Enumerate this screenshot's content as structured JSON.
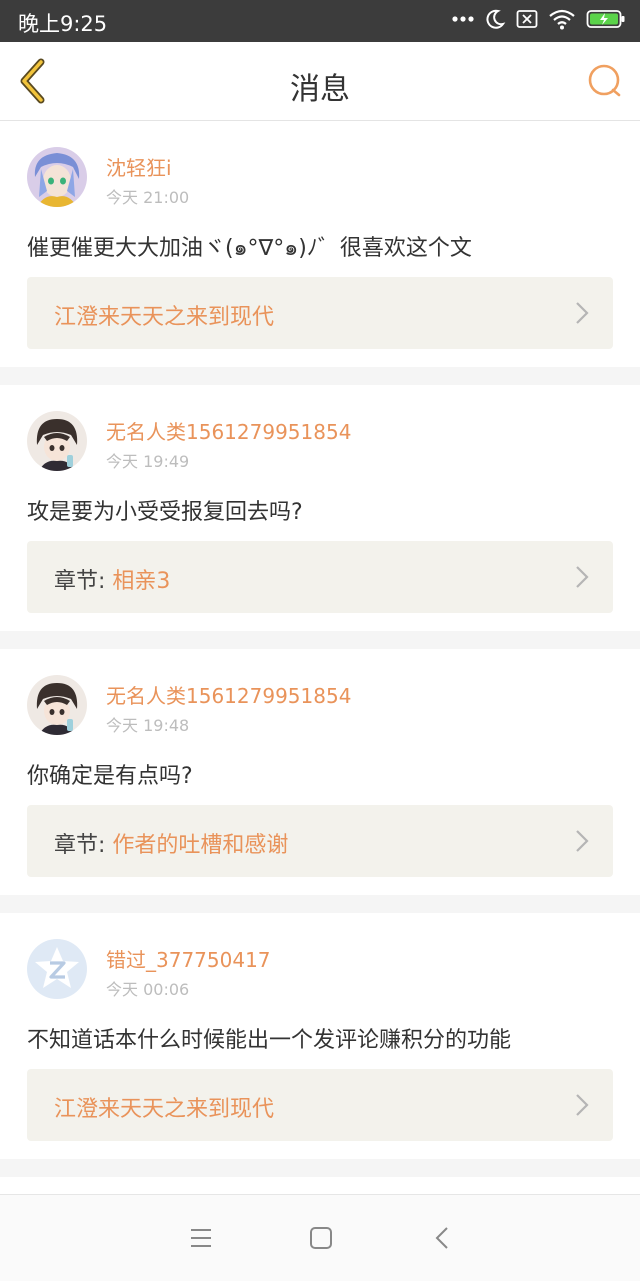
{
  "status_bar": {
    "time": "晚上9:25",
    "icons": [
      "more-dots-icon",
      "moon-icon",
      "sim-x-icon",
      "wifi-icon",
      "battery-charging-icon"
    ]
  },
  "header": {
    "title": "消息",
    "back_icon": "chevron-left-icon",
    "search_icon": "search-icon",
    "accent_color": "#e9935a"
  },
  "messages": [
    {
      "avatar": "anime-avatar",
      "username": "沈轻狂i",
      "time": "今天 21:00",
      "content": "催更催更大大加油ヾ(๑°∇°๑)ﾉ゛很喜欢这个文",
      "link": {
        "prefix": "",
        "name": "江澄来天天之来到现代"
      }
    },
    {
      "avatar": "boy-avatar",
      "username": "无名人类1561279951854",
      "time": "今天 19:49",
      "content": "攻是要为小受受报复回去吗?",
      "link": {
        "prefix": "章节: ",
        "name": "相亲3"
      }
    },
    {
      "avatar": "boy-avatar",
      "username": "无名人类1561279951854",
      "time": "今天 19:48",
      "content": "你确定是有点吗?",
      "link": {
        "prefix": "章节: ",
        "name": "作者的吐槽和感谢"
      }
    },
    {
      "avatar": "default-z-avatar",
      "username": "错过_377750417",
      "time": "今天 00:06",
      "content": "不知道话本什么时候能出一个发评论赚积分的功能",
      "link": {
        "prefix": "",
        "name": "江澄来天天之来到现代"
      }
    }
  ],
  "system_nav": {
    "buttons": [
      "menu-icon",
      "home-square-icon",
      "back-arrow-icon"
    ]
  }
}
